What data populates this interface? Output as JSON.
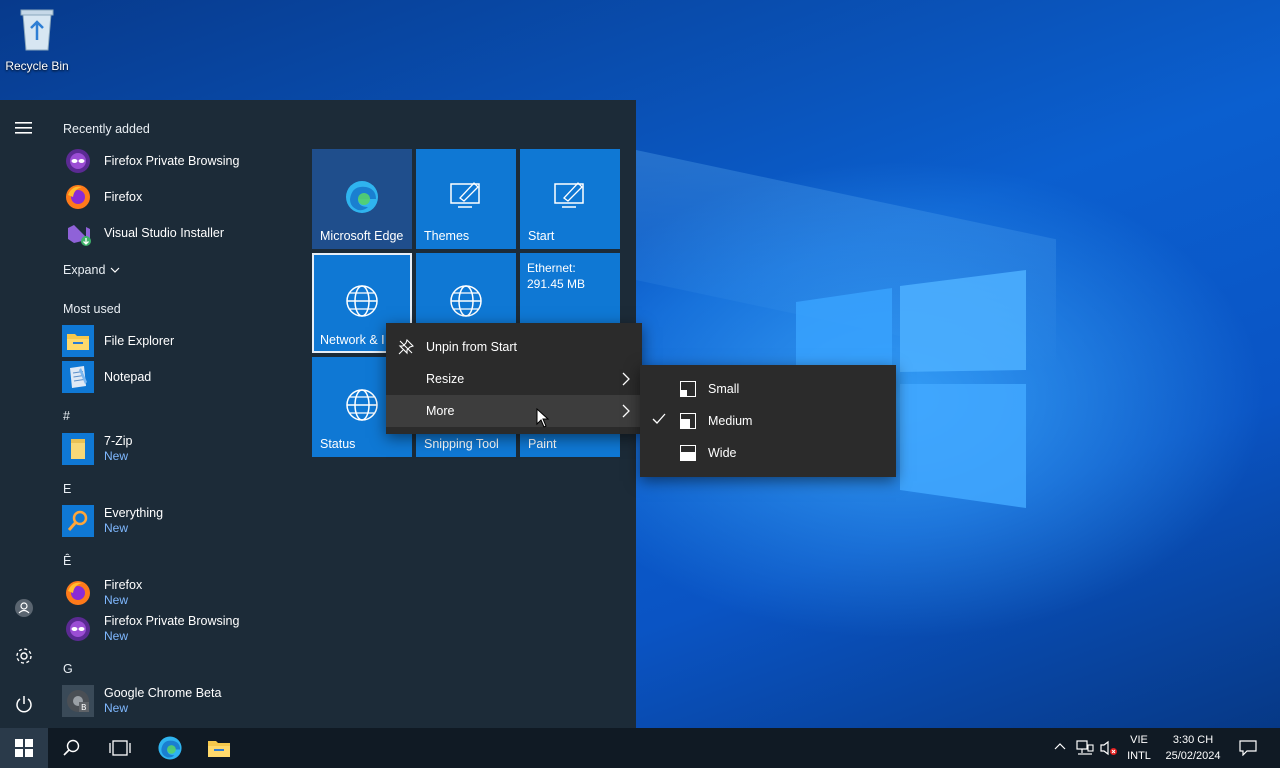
{
  "desktop": {
    "recycle_bin_label": "Recycle Bin"
  },
  "start_menu": {
    "recently_added_header": "Recently added",
    "recently_added": [
      {
        "name": "Firefox Private Browsing",
        "icon": "firefox-private-icon"
      },
      {
        "name": "Firefox",
        "icon": "firefox-icon"
      },
      {
        "name": "Visual Studio Installer",
        "icon": "visual-studio-installer-icon"
      }
    ],
    "expand_label": "Expand",
    "most_used_header": "Most used",
    "most_used": [
      {
        "name": "File Explorer",
        "icon": "file-explorer-icon"
      },
      {
        "name": "Notepad",
        "icon": "notepad-icon"
      }
    ],
    "sections": [
      {
        "letter": "#",
        "apps": [
          {
            "name": "7-Zip",
            "sub": "New"
          }
        ]
      },
      {
        "letter": "E",
        "apps": [
          {
            "name": "Everything",
            "sub": "New"
          }
        ]
      },
      {
        "letter": "Ê",
        "apps": [
          {
            "name": "Firefox",
            "sub": "New"
          },
          {
            "name": "Firefox Private Browsing",
            "sub": "New"
          }
        ]
      },
      {
        "letter": "G",
        "apps": [
          {
            "name": "Google Chrome Beta",
            "sub": "New"
          }
        ]
      }
    ]
  },
  "tiles": {
    "microsoft_edge": "Microsoft Edge",
    "themes": "Themes",
    "start": "Start",
    "network": "Network & I",
    "ethernet_title": "Ethernet:",
    "ethernet_value": "291.45 MB",
    "status": "Status",
    "snipping_tool": "Snipping Tool",
    "paint": "Paint"
  },
  "context_menu": {
    "unpin": "Unpin from Start",
    "resize": "Resize",
    "more": "More"
  },
  "resize_menu": {
    "small": "Small",
    "medium": "Medium",
    "wide": "Wide",
    "selected": "Medium"
  },
  "taskbar": {
    "lang_top": "VIE",
    "lang_bottom": "INTL",
    "time": "3:30 CH",
    "date": "25/02/2024"
  },
  "colors": {
    "tile_blue": "#0f78d4",
    "start_bg": "#1c2b38",
    "accent_sub": "#7fb8ff"
  }
}
